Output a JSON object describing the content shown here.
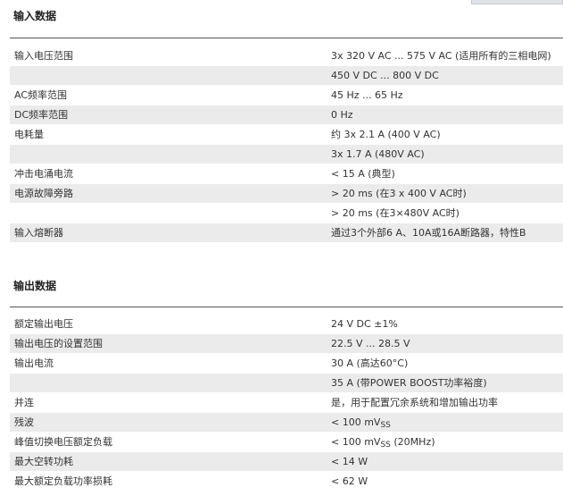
{
  "input_section": {
    "title": "输入数据",
    "rows": [
      {
        "param": "输入电压范围",
        "value": "3x 320 V AC ... 575 V AC (适用所有的三相电网)"
      },
      {
        "param": "",
        "value": "450 V DC ... 800 V DC"
      },
      {
        "param": "AC频率范围",
        "value": "45 Hz ... 65 Hz"
      },
      {
        "param": "DC频率范围",
        "value": "0 Hz"
      },
      {
        "param": "电耗量",
        "value": "约 3x 2.1 A (400 V AC)"
      },
      {
        "param": "",
        "value": "3x 1.7 A (480V AC)"
      },
      {
        "param": "冲击电涌电流",
        "value": "< 15 A (典型)"
      },
      {
        "param": "电源故障旁路",
        "value": "> 20 ms (在3 x 400 V AC时)"
      },
      {
        "param": "",
        "value": "> 20 ms (在3×480V AC时)"
      },
      {
        "param": "输入熔断器",
        "value": "通过3个外部6 A、10A或16A断路器，特性B"
      }
    ]
  },
  "output_section": {
    "title": "输出数据",
    "rows": [
      {
        "param": "额定输出电压",
        "value": "24 V DC ±1%"
      },
      {
        "param": "输出电压的设置范围",
        "value": "22.5 V ... 28.5 V"
      },
      {
        "param": "输出电流",
        "value": "30 A (高达60°C)"
      },
      {
        "param": "",
        "value": "35 A (带POWER BOOST功率裕度)"
      },
      {
        "param": "并连",
        "value": "是，用于配置冗余系统和增加输出功率"
      },
      {
        "param": "残波",
        "value": "< 100 mV",
        "value_sub": "SS",
        "value_suffix": ""
      },
      {
        "param": "峰值切换电压额定负载",
        "value": "< 100 mV",
        "value_sub": "SS",
        "value_suffix": " (20MHz)"
      },
      {
        "param": "最大空转功耗",
        "value": "< 14 W"
      },
      {
        "param": "最大额定负载功率损耗",
        "value": "< 62 W"
      }
    ]
  },
  "colors": {
    "alt_row": "#ebebeb",
    "rule": "#555555",
    "text": "#333333"
  }
}
